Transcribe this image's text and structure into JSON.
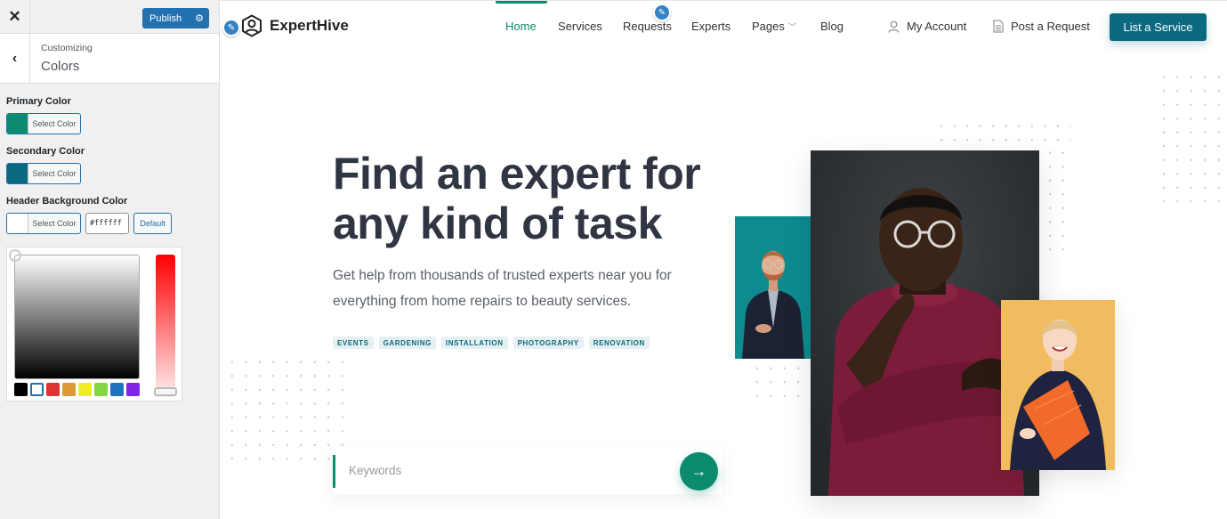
{
  "customizer": {
    "close_icon": "close-icon",
    "publish_label": "Publish",
    "settings_icon": "gear-icon",
    "back_icon": "chevron-left-icon",
    "breadcrumb": "Customizing",
    "section_title": "Colors",
    "controls": [
      {
        "label": "Primary Color",
        "button_label": "Select Color",
        "color": "#0c8b6f"
      },
      {
        "label": "Secondary Color",
        "button_label": "Select Color",
        "color": "#0b6a80"
      },
      {
        "label": "Header Background Color",
        "button_label": "Select Color",
        "color": "#ffffff",
        "hex_value": "#ffffff",
        "default_label": "Default"
      }
    ],
    "picker": {
      "hue": "#ff0000",
      "palette": [
        "#000000",
        "#ffffff",
        "#dd3333",
        "#dd9933",
        "#eeee22",
        "#81d742",
        "#1e73be",
        "#8224e3"
      ],
      "selected_palette_index": 1
    }
  },
  "site": {
    "brand": "ExpertHive",
    "nav": [
      {
        "label": "Home",
        "active": true
      },
      {
        "label": "Services"
      },
      {
        "label": "Requests"
      },
      {
        "label": "Experts"
      },
      {
        "label": "Pages",
        "dropdown": true
      },
      {
        "label": "Blog"
      }
    ],
    "account_label": "My Account",
    "post_request_label": "Post a Request",
    "cta_label": "List a Service",
    "hero": {
      "title": "Find an expert for any kind of task",
      "subtitle": "Get help from thousands of trusted experts near you for everything from home repairs to beauty services.",
      "tags": [
        "EVENTS",
        "GARDENING",
        "INSTALLATION",
        "PHOTOGRAPHY",
        "RENOVATION"
      ],
      "search_placeholder": "Keywords",
      "search_icon": "arrow-right-icon"
    },
    "images": [
      {
        "name": "man-in-suit-photo",
        "description": "Man in suit holding phone on teal background"
      },
      {
        "name": "man-in-red-sweater-photo",
        "description": "Man with glasses in red sweater, arms crossed"
      },
      {
        "name": "woman-with-folder-photo",
        "description": "Smiling woman holding orange folder on yellow background"
      }
    ],
    "colors": {
      "primary": "#0c8b6f",
      "secondary": "#0b6a80",
      "heading": "#2f3542"
    }
  }
}
